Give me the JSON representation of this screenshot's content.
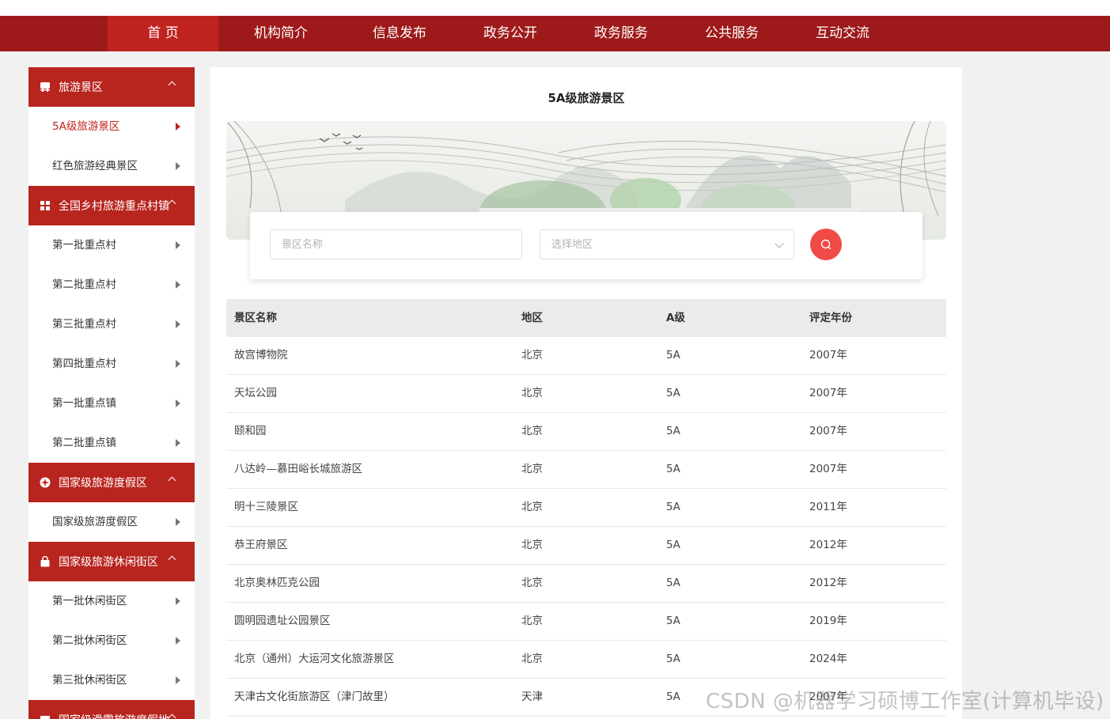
{
  "nav": [
    "首 页",
    "机构简介",
    "信息发布",
    "政务公开",
    "政务服务",
    "公共服务",
    "互动交流"
  ],
  "sidebar": {
    "sections": [
      {
        "title": "旅游景区",
        "icon": "guide-board-icon",
        "items": [
          {
            "label": "5A级旅游景区",
            "active": true
          },
          {
            "label": "红色旅游经典景区"
          }
        ]
      },
      {
        "title": "全国乡村旅游重点村镇",
        "icon": "grid-icon",
        "items": [
          {
            "label": "第一批重点村"
          },
          {
            "label": "第二批重点村"
          },
          {
            "label": "第三批重点村"
          },
          {
            "label": "第四批重点村"
          },
          {
            "label": "第一批重点镇"
          },
          {
            "label": "第二批重点镇"
          }
        ]
      },
      {
        "title": "国家级旅游度假区",
        "icon": "compass-icon",
        "items": [
          {
            "label": "国家级旅游度假区"
          }
        ]
      },
      {
        "title": "国家级旅游休闲街区",
        "icon": "shopping-bag-icon",
        "items": [
          {
            "label": "第一批休闲街区"
          },
          {
            "label": "第二批休闲街区"
          },
          {
            "label": "第三批休闲街区"
          }
        ]
      },
      {
        "title": "国家级滑雪旅游度假地",
        "icon": "snow-icon",
        "items": []
      }
    ]
  },
  "main": {
    "title": "5A级旅游景区",
    "search": {
      "name_placeholder": "景区名称",
      "region_placeholder": "选择地区",
      "button_icon": "search-icon"
    },
    "table": {
      "headers": [
        "景区名称",
        "地区",
        "A级",
        "评定年份"
      ],
      "rows": [
        [
          "故宫博物院",
          "北京",
          "5A",
          "2007年"
        ],
        [
          "天坛公园",
          "北京",
          "5A",
          "2007年"
        ],
        [
          "颐和园",
          "北京",
          "5A",
          "2007年"
        ],
        [
          "八达岭—慕田峪长城旅游区",
          "北京",
          "5A",
          "2007年"
        ],
        [
          "明十三陵景区",
          "北京",
          "5A",
          "2011年"
        ],
        [
          "恭王府景区",
          "北京",
          "5A",
          "2012年"
        ],
        [
          "北京奥林匹克公园",
          "北京",
          "5A",
          "2012年"
        ],
        [
          "圆明园遗址公园景区",
          "北京",
          "5A",
          "2019年"
        ],
        [
          "北京（通州）大运河文化旅游景区",
          "北京",
          "5A",
          "2024年"
        ],
        [
          "天津古文化街旅游区（津门故里）",
          "天津",
          "5A",
          "2007年"
        ]
      ]
    }
  },
  "watermark": "CSDN @机器学习硕博工作室(计算机毕设)",
  "colors": {
    "nav_bg": "#9e1a1a",
    "nav_active": "#c0231f",
    "section_bg": "#b8251f",
    "accent": "#c0231f",
    "search_button": "#f04b46"
  }
}
